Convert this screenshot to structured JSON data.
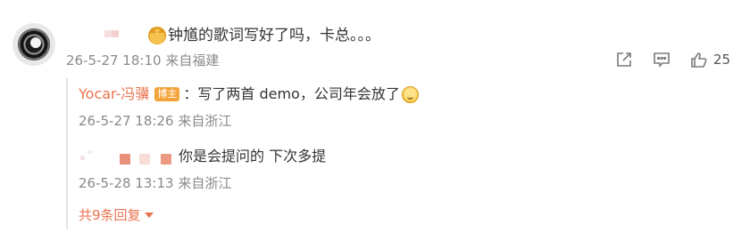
{
  "comment": {
    "text": "钟馗的歌词写好了吗，卡总。。。",
    "emoji": "cat-face",
    "time": "26-5-27 18:10",
    "source": "来自福建",
    "like_count": "25"
  },
  "replies": [
    {
      "author": "Yocar-冯骥",
      "badge": "博主",
      "text": "：写了两首 demo，公司年会放了",
      "emoji": "smile",
      "time": "26-5-27 18:26",
      "source": "来自浙江"
    },
    {
      "author": "",
      "text": "你是会提问的  下次多提",
      "time": "26-5-28 13:13",
      "source": "来自浙江"
    }
  ],
  "more_replies_label": "共9条回复",
  "colors": {
    "accent": "#eb7350",
    "badge": "#f3a53c",
    "meta": "#8a8a8a"
  },
  "icons": [
    "share-icon",
    "comment-icon",
    "like-icon"
  ]
}
